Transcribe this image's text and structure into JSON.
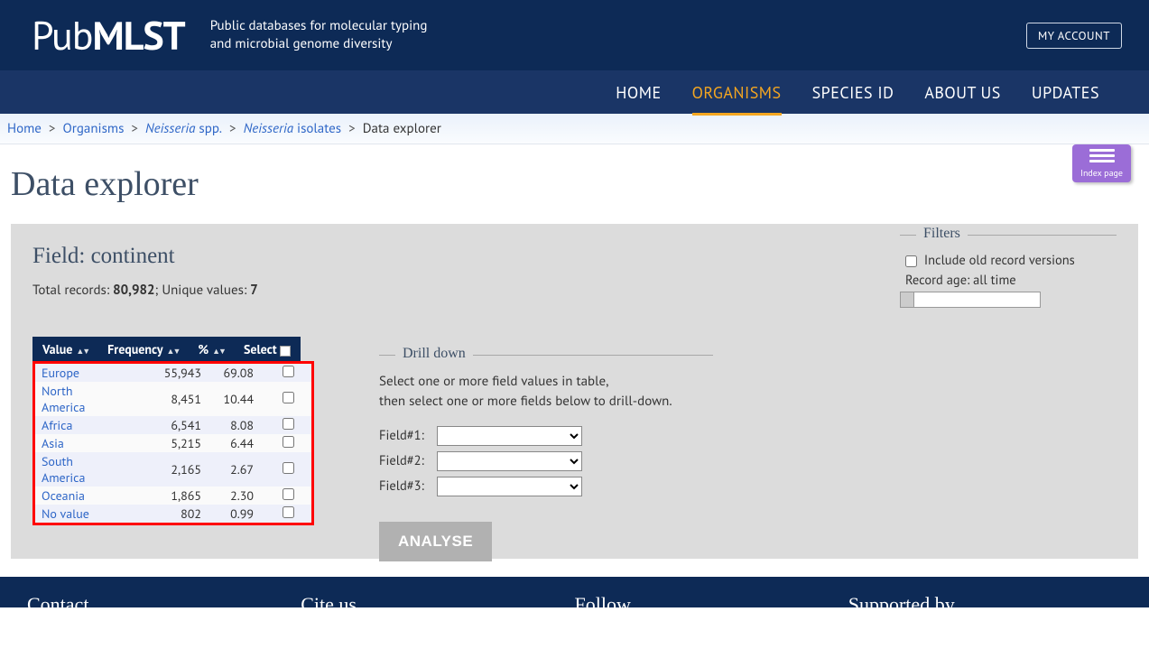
{
  "header": {
    "logo_prefix": "Pub",
    "logo_bold": "MLST",
    "tagline_l1": "Public databases for molecular typing",
    "tagline_l2": "and microbial genome diversity",
    "my_account": "MY ACCOUNT"
  },
  "nav": {
    "items": [
      "HOME",
      "ORGANISMS",
      "SPECIES ID",
      "ABOUT US",
      "UPDATES"
    ],
    "active": "ORGANISMS"
  },
  "breadcrumb": {
    "home": "Home",
    "organisms": "Organisms",
    "neisseria_spp_em": "Neisseria",
    "neisseria_spp_rest": " spp.",
    "neisseria_iso_em": "Neisseria",
    "neisseria_iso_rest": " isolates",
    "current": "Data explorer"
  },
  "index_widget": {
    "label": "Index page"
  },
  "page_title": "Data explorer",
  "field": {
    "heading": "Field: continent",
    "total_label": "Total records: ",
    "total_value": "80,982",
    "unique_label": "; Unique values: ",
    "unique_value": "7"
  },
  "table": {
    "headers": {
      "value": "Value",
      "frequency": "Frequency",
      "percent": "%",
      "select": "Select"
    },
    "rows": [
      {
        "value": "Europe",
        "frequency": "55,943",
        "percent": "69.08"
      },
      {
        "value": "North America",
        "frequency": "8,451",
        "percent": "10.44"
      },
      {
        "value": "Africa",
        "frequency": "6,541",
        "percent": "8.08"
      },
      {
        "value": "Asia",
        "frequency": "5,215",
        "percent": "6.44"
      },
      {
        "value": "South America",
        "frequency": "2,165",
        "percent": "2.67"
      },
      {
        "value": "Oceania",
        "frequency": "1,865",
        "percent": "2.30"
      },
      {
        "value": "No value",
        "frequency": "802",
        "percent": "0.99"
      }
    ]
  },
  "drilldown": {
    "legend": "Drill down",
    "instr_l1": "Select one or more field values in table,",
    "instr_l2": "then select one or more fields below to drill-down.",
    "field1_label": "Field#1:",
    "field2_label": "Field#2:",
    "field3_label": "Field#3:",
    "analyse": "ANALYSE"
  },
  "filters": {
    "legend": "Filters",
    "include_old": "Include old record versions",
    "record_age": "Record age: all time"
  },
  "footer": {
    "contact": "Contact",
    "cite": "Cite us",
    "follow": "Follow",
    "supported": "Supported by"
  }
}
